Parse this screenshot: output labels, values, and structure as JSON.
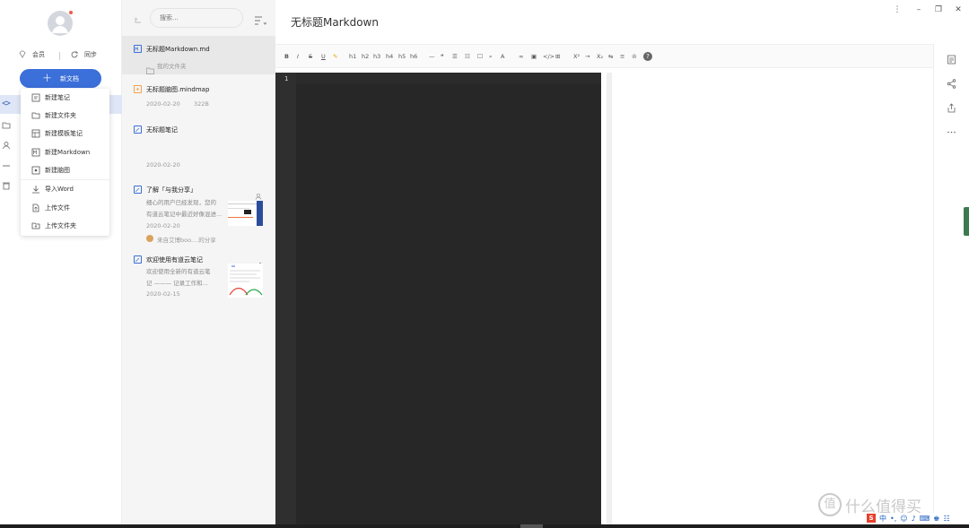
{
  "sidebar": {
    "vip_label": "会员",
    "sync_label": "同步",
    "new_doc_label": "新文档"
  },
  "new_menu": {
    "items": [
      {
        "label": "新建笔记"
      },
      {
        "label": "新建文件夹"
      },
      {
        "label": "新建模板笔记"
      },
      {
        "label": "新建Markdown"
      },
      {
        "label": "新建脑图"
      },
      {
        "label": "导入Word"
      },
      {
        "label": "上传文件"
      },
      {
        "label": "上传文件夹"
      }
    ]
  },
  "note_list": {
    "search_placeholder": "搜索...",
    "notes": [
      {
        "title": "无标题Markdown.md",
        "folder": "我的文件夹"
      },
      {
        "title": "无标题脑图.mindmap",
        "date": "2020-02-20",
        "size": "322B"
      },
      {
        "title": "无标题笔记",
        "date": "2020-02-20"
      },
      {
        "title": "了解「与我分享」",
        "line1": "细心的用户已经发现，您的",
        "line2": "有道云笔记中最近好像混进...",
        "date": "2020-02-20",
        "shared_by": "来自艾博boo....的分享"
      },
      {
        "title": "欢迎使用有道云笔记",
        "line1": "欢迎使用全新的有道云笔",
        "line2": "记 ——— 记录工作和...",
        "date": "2020-02-15"
      }
    ]
  },
  "editor": {
    "title": "无标题Markdown",
    "toolbar": [
      "B",
      "I",
      "S",
      "U",
      "h1",
      "h2",
      "h3",
      "h4",
      "h5",
      "h6",
      "X²",
      "X₂"
    ],
    "line_number": "1"
  },
  "watermark": {
    "text": "什么值得买",
    "badge": "值"
  },
  "ime": {
    "lang": "中"
  },
  "colors": {
    "accent": "#3b6fd9",
    "mindmap": "#f5a04a",
    "code_bg": "#272727"
  }
}
